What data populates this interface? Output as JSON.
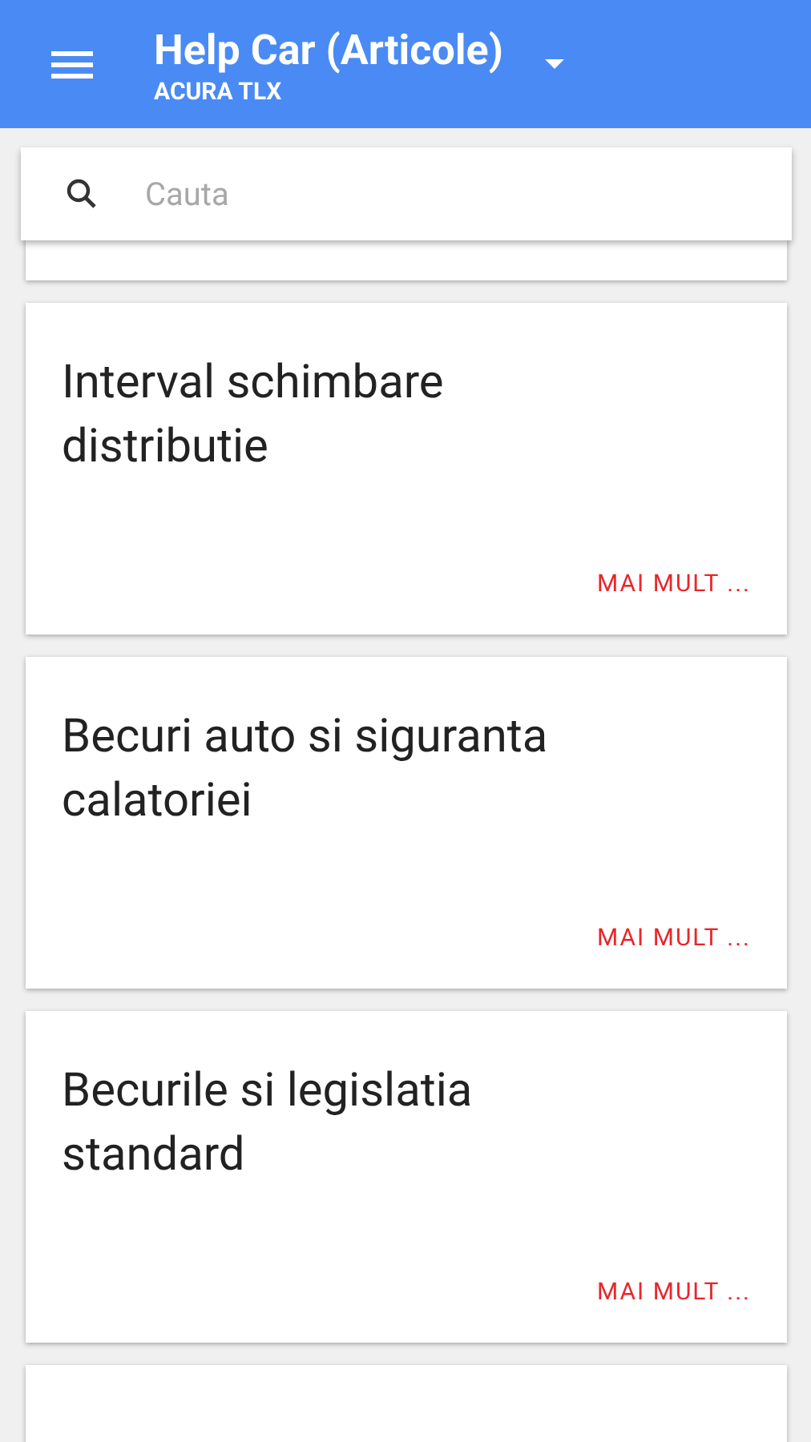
{
  "app_bar": {
    "title": "Help Car (Articole)",
    "subtitle": "ACURA TLX"
  },
  "search": {
    "placeholder": "Cauta"
  },
  "articles": [
    {
      "kind": "partial"
    },
    {
      "kind": "article",
      "title": "Interval schimbare distributie",
      "more": "MAI MULT ..."
    },
    {
      "kind": "article",
      "title": "Becuri auto si siguranta calatoriei",
      "more": "MAI MULT ..."
    },
    {
      "kind": "article",
      "title": "Becurile si legislatia standard",
      "more": "MAI MULT ..."
    },
    {
      "kind": "clipped"
    }
  ]
}
